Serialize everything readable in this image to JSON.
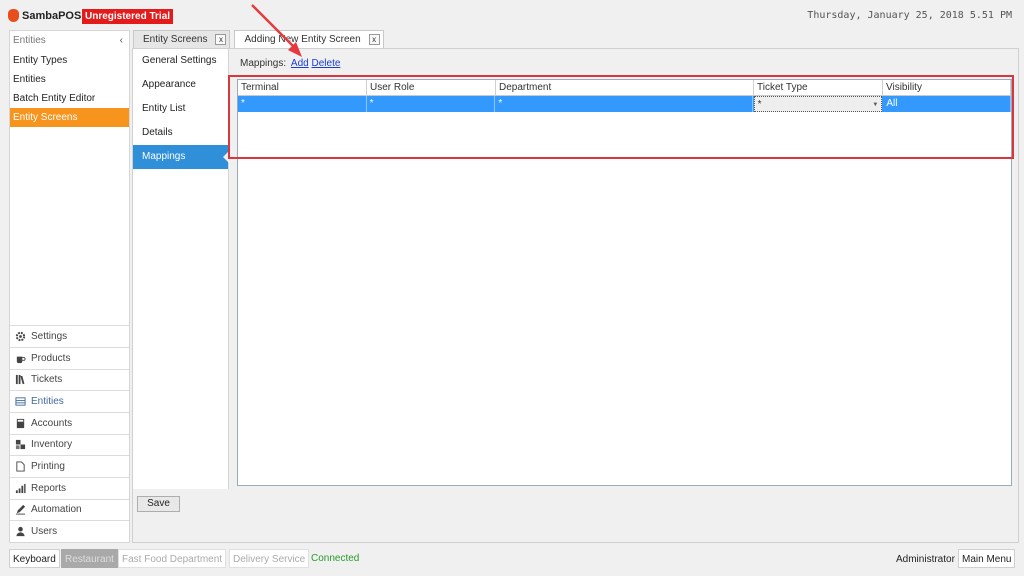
{
  "app": {
    "logo_name": "SambaPOS",
    "trial_badge": "Unregistered Trial",
    "datetime": "Thursday, January 25, 2018 5.51 PM",
    "accent_color": "#f7941e",
    "brand_color": "#e31b1b"
  },
  "sidebar": {
    "header": "Entities",
    "collapse_glyph": "‹",
    "items": [
      {
        "label": "Entity Types"
      },
      {
        "label": "Entities"
      },
      {
        "label": "Batch Entity Editor"
      },
      {
        "label": "Entity Screens",
        "active": true
      }
    ],
    "sections": [
      {
        "label": "Settings",
        "icon": "gear-icon"
      },
      {
        "label": "Products",
        "icon": "coffee-icon"
      },
      {
        "label": "Tickets",
        "icon": "books-icon"
      },
      {
        "label": "Entities",
        "icon": "table-icon",
        "active": true
      },
      {
        "label": "Accounts",
        "icon": "calculator-icon"
      },
      {
        "label": "Inventory",
        "icon": "boxes-icon"
      },
      {
        "label": "Printing",
        "icon": "document-icon"
      },
      {
        "label": "Reports",
        "icon": "bar-chart-icon"
      },
      {
        "label": "Automation",
        "icon": "pen-icon"
      },
      {
        "label": "Users",
        "icon": "user-icon"
      }
    ]
  },
  "tabs": [
    {
      "label": "Entity Screens",
      "close": "x"
    },
    {
      "label": "Adding New Entity Screen",
      "close": "x",
      "active": true
    }
  ],
  "settings_nav": [
    {
      "label": "General Settings"
    },
    {
      "label": "Appearance"
    },
    {
      "label": "Entity List"
    },
    {
      "label": "Details"
    },
    {
      "label": "Mappings",
      "active": true
    }
  ],
  "mappings": {
    "label": "Mappings:",
    "add_link": "Add",
    "delete_link": "Delete",
    "columns": [
      "Terminal",
      "User Role",
      "Department",
      "Ticket Type",
      "Visibility"
    ],
    "rows": [
      [
        "*",
        "*",
        "*",
        "*",
        "All"
      ]
    ]
  },
  "save_label": "Save",
  "statusbar": {
    "keyboard": "Keyboard",
    "restaurant": "Restaurant",
    "fast_food": "Fast Food Department",
    "delivery": "Delivery Service",
    "connected": "Connected",
    "user": "Administrator",
    "main_menu": "Main Menu"
  }
}
